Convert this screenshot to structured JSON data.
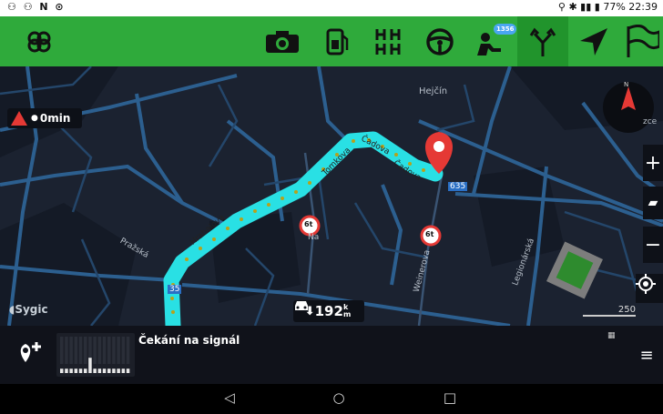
{
  "status_bar": {
    "left_icons": [
      "notification-icon",
      "notification-icon",
      "n-icon",
      "circle-icon"
    ],
    "battery": "77%",
    "time": "22:39"
  },
  "toolbar": {
    "items": [
      "menu-logo-icon",
      "camera-icon",
      "fuel-icon",
      "parking-grid-icon",
      "steering-wheel-icon",
      "traffic-report-icon",
      "route-fork-icon",
      "navigate-arrow-icon",
      "flag-icon"
    ],
    "badge": "1356",
    "active": "route-fork-icon"
  },
  "map": {
    "labels": {
      "hejcin": "Hejčín",
      "cadova1": "Čadova",
      "cadova2": "Čadova",
      "tomkova": "Tomkova",
      "hrabalova": "Hrabalova",
      "prazska": "Pražská",
      "weinerova": "Weinerova",
      "na": "Na",
      "legionarska": "Legionárská"
    },
    "road_number_635": "635",
    "road_number_35": "35",
    "speed_signs": [
      "6t",
      "6t"
    ],
    "brand": "Sygic",
    "scale": "250",
    "compass": "N",
    "edge_label": "zce"
  },
  "delay_chip": {
    "value": "0min"
  },
  "distance_chip": {
    "value": "192",
    "unit_k": "k",
    "unit_m": "m"
  },
  "bottom_bar": {
    "signal_text": "Čekání na signál",
    "signal_bars": [
      2,
      2,
      2,
      2,
      2,
      2,
      7,
      2,
      2,
      2,
      2,
      2,
      2,
      2,
      2
    ]
  },
  "colors": {
    "toolbar_green": "#2faa3b",
    "route_cyan": "#29e0e4",
    "pin_red": "#e53935"
  }
}
